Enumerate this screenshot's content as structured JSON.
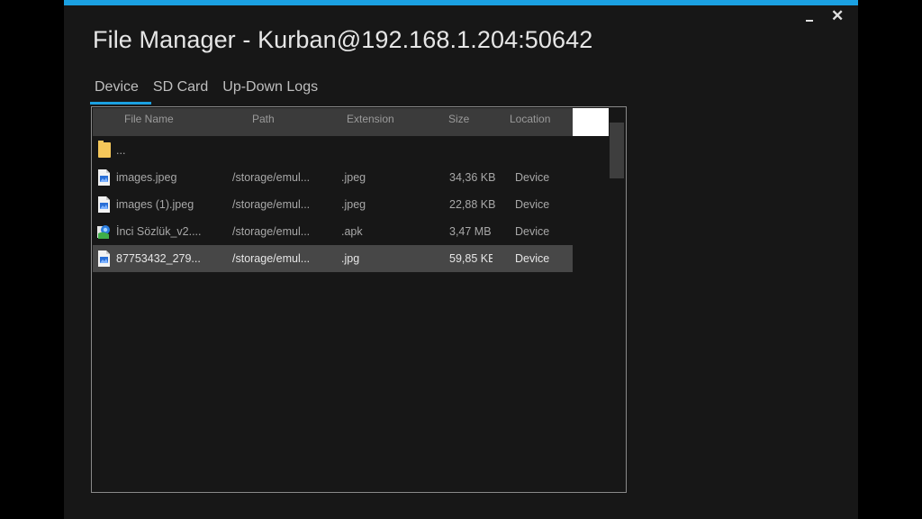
{
  "window": {
    "title": "File Manager - Kurban@192.168.1.204:50642",
    "minimize_glyph": "_",
    "close_glyph": "✕",
    "accent_color": "#1ba1e2"
  },
  "tabs": [
    {
      "label": "Device",
      "active": true
    },
    {
      "label": "SD Card",
      "active": false
    },
    {
      "label": "Up-Down Logs",
      "active": false
    }
  ],
  "columns": [
    "File Name",
    "Path",
    "Extension",
    "Size",
    "Location"
  ],
  "rows": [
    {
      "icon": "folder-icon",
      "name": "...",
      "path": "",
      "extension": "",
      "size": "",
      "location": ""
    },
    {
      "icon": "image-file-icon",
      "name": "images.jpeg",
      "path": "/storage/emul...",
      "extension": ".jpeg",
      "size": "34,36 KB",
      "location": "Device"
    },
    {
      "icon": "image-file-icon",
      "name": "images (1).jpeg",
      "path": "/storage/emul...",
      "extension": ".jpeg",
      "size": "22,88 KB",
      "location": "Device"
    },
    {
      "icon": "apk-file-icon",
      "name": "İnci Sözlük_v2....",
      "path": "/storage/emul...",
      "extension": ".apk",
      "size": "3,47 MB",
      "location": "Device"
    },
    {
      "icon": "image-file-icon",
      "name": "87753432_279...",
      "path": "/storage/emul...",
      "extension": ".jpg",
      "size": "59,85 KE",
      "location": "Device",
      "selected": true
    }
  ]
}
